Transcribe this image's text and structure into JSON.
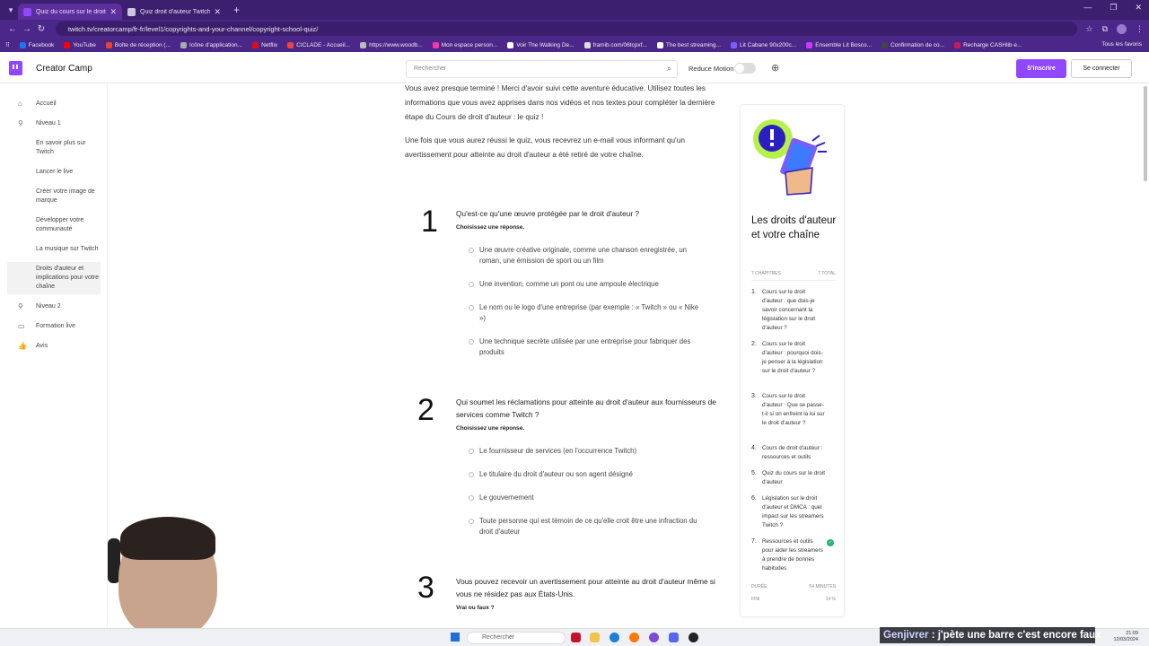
{
  "browser": {
    "tabs": [
      {
        "title": "Quiz du cours sur le droit d'auteur",
        "active": true
      },
      {
        "title": "Quiz droit d'auteur Twitch",
        "active": false
      }
    ],
    "url": "twitch.tv/creatorcamp/fr-fr/level1/copyrights-and-your-channel/copyright-school-quiz/",
    "bookmarks": [
      "Facebook",
      "YouTube",
      "Boîte de réception (...",
      "Icône d'application...",
      "Netflix",
      "CICLADE - Accueil...",
      "https://www.woodb...",
      "Mon espace person...",
      "Voir The Walking De...",
      "framib.com/06tcpxf...",
      "The best streaming...",
      "Lit Cabane 90x200c...",
      "Ensemble Lit Bosco...",
      "Confirmation de co...",
      "Recharge CASHlib e..."
    ],
    "all_bookmarks": "Tous les favoris"
  },
  "header": {
    "brand": "Creator Camp",
    "search_placeholder": "Rechercher",
    "reduce_motion": "Reduce Motion",
    "signup": "S'inscrire",
    "login": "Se connecter"
  },
  "sidebar": {
    "items": [
      {
        "label": "Accueil",
        "icon": "home-icon"
      },
      {
        "label": "Niveau 1",
        "icon": "level-icon"
      },
      {
        "label": "En savoir plus sur Twitch"
      },
      {
        "label": "Lancer le live"
      },
      {
        "label": "Créer votre image de marque"
      },
      {
        "label": "Développer votre communauté"
      },
      {
        "label": "La musique sur Twitch"
      },
      {
        "label": "Droits d'auteur et implications pour votre chaîne"
      },
      {
        "label": "Niveau 2",
        "icon": "level-icon"
      },
      {
        "label": "Formation live",
        "icon": "live-icon"
      },
      {
        "label": "Avis",
        "icon": "thumbs-up-icon"
      }
    ]
  },
  "main": {
    "intro1": "Vous avez presque terminé ! Merci d'avoir suivi cette aventure éducative. Utilisez toutes les informations que vous avez apprises dans nos vidéos et nos textes pour compléter la dernière étape du Cours de droit d'auteur : le quiz !",
    "intro2": "Une fois que vous aurez réussi le quiz, vous recevrez un e-mail vous informant qu'un avertissement pour atteinte au droit d'auteur a été retiré de votre chaîne.",
    "questions": [
      {
        "number": "1",
        "text": "Qu'est-ce qu'une œuvre protégée par le droit d'auteur ?",
        "hint": "Choisissez une réponse.",
        "options": [
          "Une œuvre créative originale, comme une chanson enregistrée, un roman, une émission de sport ou un film",
          "Une invention, comme un pont ou une ampoule électrique",
          "Le nom ou le logo d'une entreprise (par exemple : « Twitch » ou « Nike »)",
          "Une technique secrète utilisée par une entreprise pour fabriquer des produits"
        ]
      },
      {
        "number": "2",
        "text": "Qui soumet les réclamations pour atteinte au droit d'auteur aux fournisseurs de services comme Twitch ?",
        "hint": "Choisissez une réponse.",
        "options": [
          "Le fournisseur de services (en l'occurrence Twitch)",
          "Le titulaire du droit d'auteur ou son agent désigné",
          "Le gouvernement",
          "Toute personne qui est témoin de ce qu'elle croit être une infraction du droit d'auteur"
        ]
      },
      {
        "number": "3",
        "text": "Vous pouvez recevoir un avertissement pour atteinte au droit d'auteur même si vous ne résidez pas aux États-Unis.",
        "hint": "Vrai ou faux ?",
        "options": []
      }
    ]
  },
  "card": {
    "title": "Les droits d'auteur et votre chaîne",
    "chapters_label": "7 CHAPITRES",
    "total_label": "7 TOTAL",
    "chapters": [
      "Cours sur le droit d'auteur : que dois-je savoir concernant la législation sur le droit d'auteur ?",
      "Cours sur le droit d'auteur : pourquoi dois-je penser à la législation sur le droit d'auteur ?",
      "Cours sur le droit d'auteur : Que se passe-t-il si on enfreint la loi sur le droit d'auteur ?",
      "Cours de droit d'auteur : ressources et outils",
      "Quiz du cours sur le droit d'auteur",
      "Législation sur le droit d'auteur et DMCA : quel impact sur les streamers Twitch ?",
      "Ressources et outils pour aider les streamers à prendre de bonnes habitudes"
    ],
    "duration_label": "DURÉE",
    "duration_value": "54 MINUTES",
    "progress_label": "FINI",
    "progress_value": "14 %"
  },
  "taskbar": {
    "search": "Rechercher",
    "time": "21:09",
    "date": "12/03/2024"
  },
  "chat": {
    "user": "Genjivrer",
    "message": " : j'pète une barre c'est encore faux"
  },
  "colors": {
    "brand": "#9146ff",
    "browser_bar": "#3c1f6e",
    "done": "#22b573"
  }
}
